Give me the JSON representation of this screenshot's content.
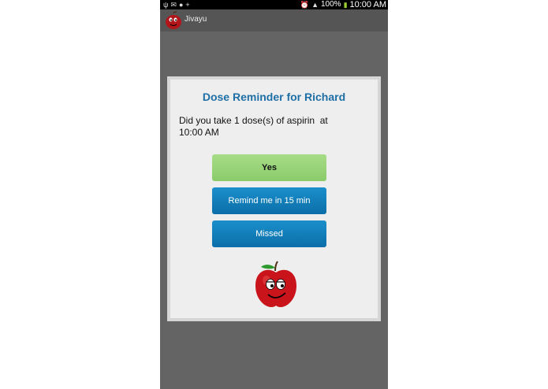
{
  "status_bar": {
    "battery": "100%",
    "time": "10:00 AM",
    "icons": [
      "usb-icon",
      "mail-icon",
      "chat-icon",
      "add-contact-icon",
      "alarm-icon",
      "wifi-icon",
      "battery-icon"
    ]
  },
  "app_bar": {
    "title": "Jivayu"
  },
  "dialog": {
    "title": "Dose Reminder for Richard",
    "message_line1": "Did you take 1 dose(s) of aspirin  at",
    "message_line2": "10:00 AM",
    "buttons": {
      "yes": "Yes",
      "remind": "Remind me in 15 min",
      "missed": "Missed"
    }
  },
  "colors": {
    "title": "#1e6fa6",
    "yes_button": "#94d174",
    "blue_button": "#1280bd",
    "overlay": "#646464"
  }
}
